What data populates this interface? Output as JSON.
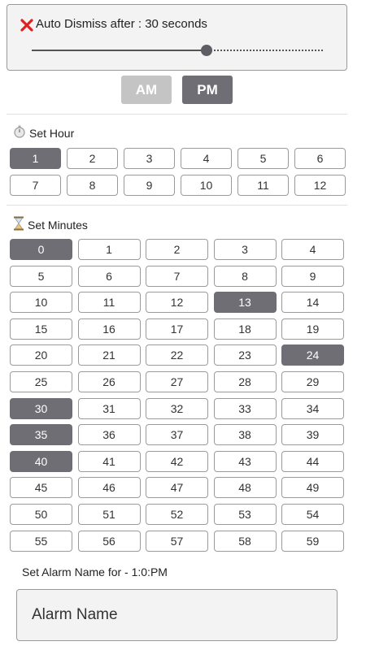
{
  "dismiss": {
    "label": "Auto Dismiss after : 30 seconds",
    "slider_fraction": 0.6
  },
  "ampm": {
    "am_label": "AM",
    "pm_label": "PM",
    "selected": "PM"
  },
  "hours": {
    "label": "Set Hour",
    "items": [
      "1",
      "2",
      "3",
      "4",
      "5",
      "6",
      "7",
      "8",
      "9",
      "10",
      "11",
      "12"
    ],
    "selected": [
      "1"
    ]
  },
  "minutes": {
    "label": "Set Minutes",
    "items": [
      "0",
      "1",
      "2",
      "3",
      "4",
      "5",
      "6",
      "7",
      "8",
      "9",
      "10",
      "11",
      "12",
      "13",
      "14",
      "15",
      "16",
      "17",
      "18",
      "19",
      "20",
      "21",
      "22",
      "23",
      "24",
      "25",
      "26",
      "27",
      "28",
      "29",
      "30",
      "31",
      "32",
      "33",
      "34",
      "35",
      "36",
      "37",
      "38",
      "39",
      "40",
      "41",
      "42",
      "43",
      "44",
      "45",
      "46",
      "47",
      "48",
      "49",
      "50",
      "51",
      "52",
      "53",
      "54",
      "55",
      "56",
      "57",
      "58",
      "59"
    ],
    "selected": [
      "0",
      "13",
      "24",
      "30",
      "35",
      "40"
    ]
  },
  "alarm": {
    "caption": "Set Alarm Name for - 1:0:PM",
    "placeholder": "Alarm Name",
    "value": ""
  },
  "colors": {
    "selected": "#6f6e75",
    "inactive_am": "#c4c4c4",
    "dismiss_x": "#e02020"
  }
}
